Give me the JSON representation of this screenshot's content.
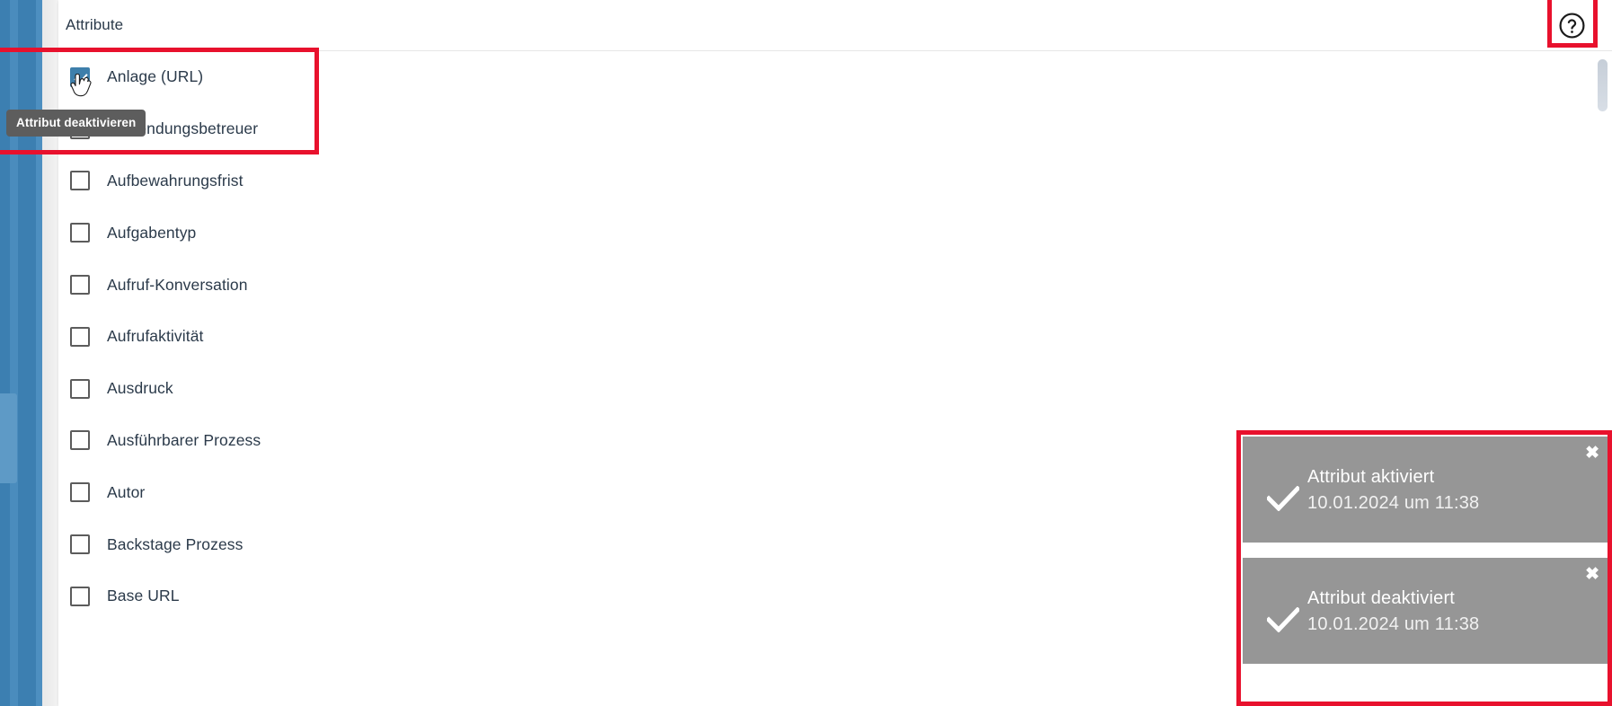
{
  "window": {
    "left_rail_accent_color": "#3c7fb1",
    "card_background": "#ffffff"
  },
  "header": {
    "title": "Attribute",
    "help_icon": "question-circle-icon"
  },
  "list": {
    "items": [
      {
        "label": "Anlage (URL)",
        "checked": true
      },
      {
        "label": "Anwendungsbetreuer",
        "checked": false
      },
      {
        "label": "Aufbewahrungsfrist",
        "checked": false
      },
      {
        "label": "Aufgabentyp",
        "checked": false
      },
      {
        "label": "Aufruf-Konversation",
        "checked": false
      },
      {
        "label": "Aufrufaktivität",
        "checked": false
      },
      {
        "label": "Ausdruck",
        "checked": false
      },
      {
        "label": "Ausführbarer Prozess",
        "checked": false
      },
      {
        "label": "Autor",
        "checked": false
      },
      {
        "label": "Backstage Prozess",
        "checked": false
      },
      {
        "label": "Base URL",
        "checked": false
      }
    ]
  },
  "tooltip": {
    "text": "Attribut deaktivieren"
  },
  "toasts": [
    {
      "icon": "check-icon",
      "title": "Attribut aktiviert",
      "timestamp": "10.01.2024 um 11:38",
      "close_label": "✖",
      "background": "#969696"
    },
    {
      "icon": "check-icon",
      "title": "Attribut deaktiviert",
      "timestamp": "10.01.2024 um 11:38",
      "close_label": "✖",
      "background": "#969696"
    }
  ],
  "annotations": {
    "highlight_color": "#e8112d",
    "boxes": [
      {
        "name": "first-item",
        "target": "Anlage (URL) row + tooltip"
      },
      {
        "name": "help",
        "target": "help icon"
      },
      {
        "name": "toasts",
        "target": "toast notifications"
      }
    ]
  },
  "checkbox_colors": {
    "checked_fill": "#3e7fab",
    "unchecked_border": "#5c5c5c",
    "halo": "#f3f7fb"
  },
  "scrollbar": {
    "thumb_color": "#c6ced8"
  }
}
